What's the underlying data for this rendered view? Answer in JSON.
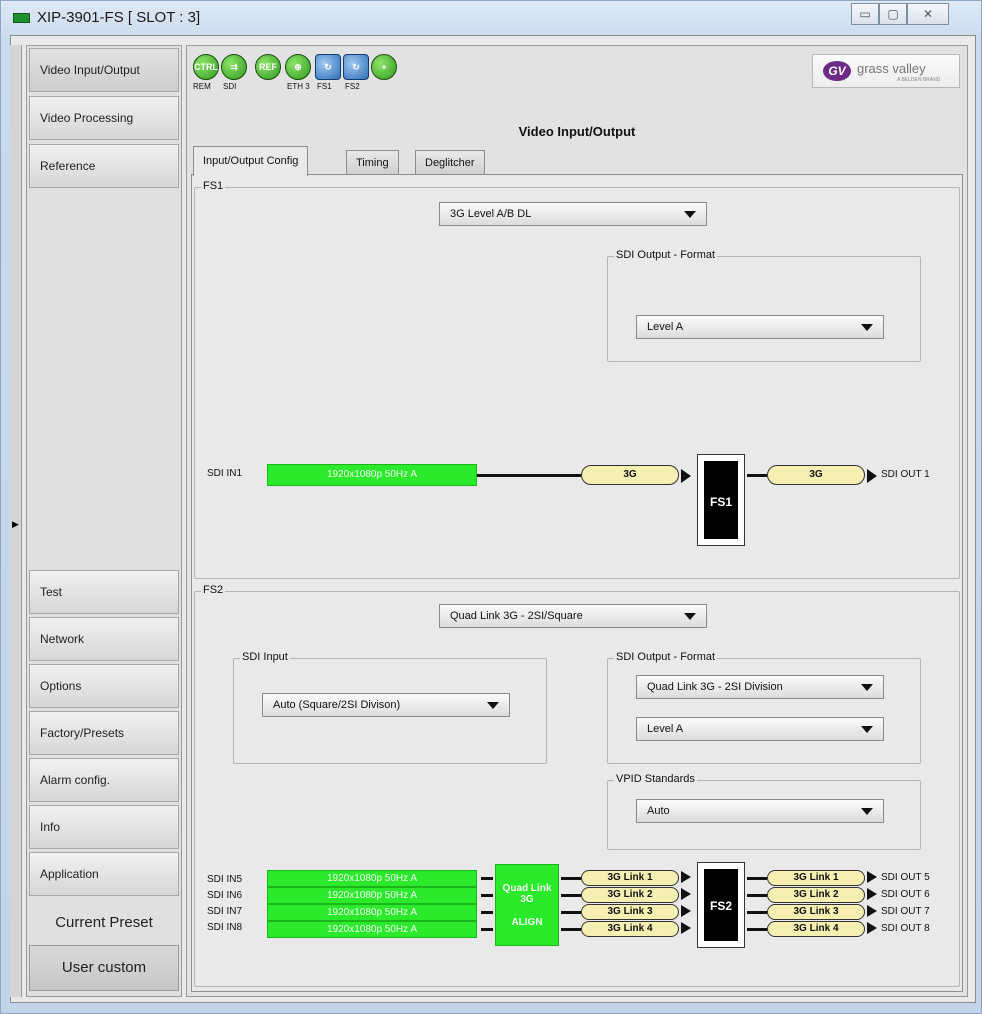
{
  "window": {
    "title": "XIP-3901-FS [ SLOT : 3]",
    "min": "▭",
    "max": "▢",
    "close": "✕"
  },
  "nav": {
    "top": [
      "Video Input/Output",
      "Video Processing",
      "Reference"
    ],
    "bottom": [
      "Test",
      "Network",
      "Options",
      "Factory/Presets",
      "Alarm config.",
      "Info",
      "Application"
    ],
    "preset_label": "Current Preset",
    "preset_value": "User custom"
  },
  "toolbar": {
    "icons": [
      {
        "text": "CTRL",
        "label": "REM"
      },
      {
        "text": "⇉",
        "label": "SDI"
      },
      {
        "text": "REF",
        "label": ""
      },
      {
        "text": "⊕",
        "label": "ETH 3"
      },
      {
        "text": "↻",
        "label": "FS1"
      },
      {
        "text": "↻",
        "label": "FS2"
      },
      {
        "text": "+",
        "label": ""
      }
    ],
    "logo": {
      "mark": "GV",
      "name": "grass valley",
      "sub": "A BELDEN BRAND"
    }
  },
  "page_title": "Video Input/Output",
  "tabs": [
    "Input/Output Config",
    "Timing",
    "Deglitcher"
  ],
  "fs1": {
    "legend": "FS1",
    "mode": "3G Level A/B DL",
    "out_group": "SDI Output - Format",
    "out_format": "Level A",
    "in_label": "SDI IN1",
    "in_signal": "1920x1080p 50Hz A",
    "pill_in": "3G",
    "box": "FS1",
    "pill_out": "3G",
    "out_label": "SDI OUT 1"
  },
  "fs2": {
    "legend": "FS2",
    "mode": "Quad Link 3G - 2SI/Square",
    "in_group": "SDI Input",
    "in_format": "Auto (Square/2SI Divison)",
    "out_group": "SDI Output - Format",
    "out_format1": "Quad Link 3G - 2SI Division",
    "out_format2": "Level A",
    "vpid_group": "VPID Standards",
    "vpid": "Auto",
    "qbox_top": "Quad Link 3G",
    "qbox_bottom": "ALIGN",
    "box": "FS2",
    "inputs": [
      "SDI IN5",
      "SDI IN6",
      "SDI IN7",
      "SDI IN8"
    ],
    "signals": [
      "1920x1080p 50Hz A",
      "1920x1080p 50Hz A",
      "1920x1080p 50Hz A",
      "1920x1080p 50Hz A"
    ],
    "links_in": [
      "3G Link 1",
      "3G Link 2",
      "3G Link 3",
      "3G Link 4"
    ],
    "links_out": [
      "3G Link 1",
      "3G Link 2",
      "3G Link 3",
      "3G Link 4"
    ],
    "outputs": [
      "SDI OUT 5",
      "SDI OUT 6",
      "SDI OUT 7",
      "SDI OUT 8"
    ]
  }
}
